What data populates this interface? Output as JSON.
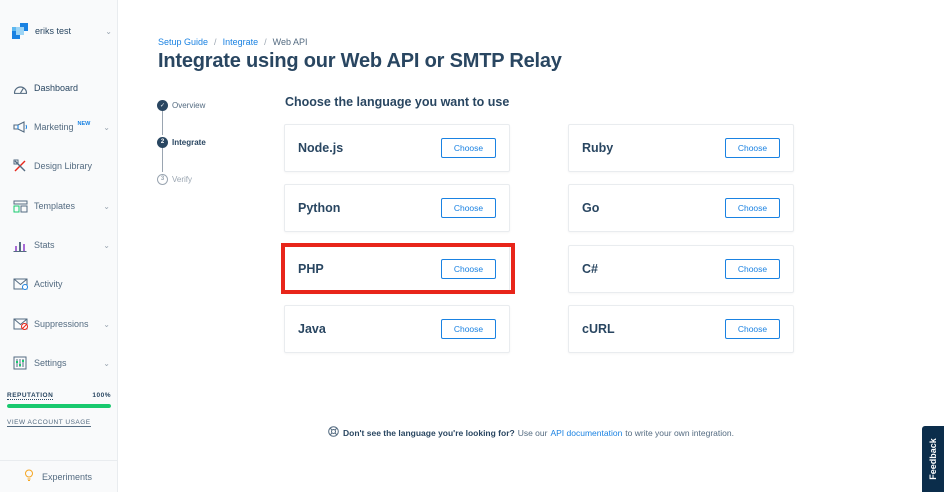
{
  "account": {
    "name": "eriks test"
  },
  "sidebar": {
    "items": [
      {
        "label": "Dashboard",
        "icon": "gauge-icon"
      },
      {
        "label": "Marketing",
        "icon": "megaphone-icon",
        "badge": "NEW"
      },
      {
        "label": "Design Library",
        "icon": "design-tools-icon"
      },
      {
        "label": "Templates",
        "icon": "templates-icon"
      },
      {
        "label": "Stats",
        "icon": "bar-chart-icon"
      },
      {
        "label": "Activity",
        "icon": "envelope-icon"
      },
      {
        "label": "Suppressions",
        "icon": "suppression-icon"
      },
      {
        "label": "Settings",
        "icon": "sliders-icon"
      }
    ],
    "reputation": {
      "label": "REPUTATION",
      "value": "100%",
      "fraction": 1.0
    },
    "view_usage": "VIEW ACCOUNT USAGE",
    "experiments": "Experiments"
  },
  "breadcrumb": {
    "items": [
      "Setup Guide",
      "Integrate",
      "Web API"
    ],
    "separator": "/"
  },
  "page_title": "Integrate using our Web API or SMTP Relay",
  "steps": [
    "Overview",
    "Integrate",
    "Verify"
  ],
  "step_number_active": "2",
  "step_number_pending": "3",
  "section_title": "Choose the language you want to use",
  "choose_label": "Choose",
  "languages": {
    "left": [
      "Node.js",
      "Python",
      "PHP",
      "Java"
    ],
    "right": [
      "Ruby",
      "Go",
      "C#",
      "cURL"
    ]
  },
  "footer": {
    "bold": "Don't see the language you're looking for?",
    "pre": "Use our",
    "link": "API documentation",
    "post": "to write your own integration."
  },
  "feedback": "Feedback",
  "colors": {
    "accent": "#1a82e2",
    "navy": "#294661",
    "success": "#18c96e",
    "highlight": "#e8251a"
  }
}
